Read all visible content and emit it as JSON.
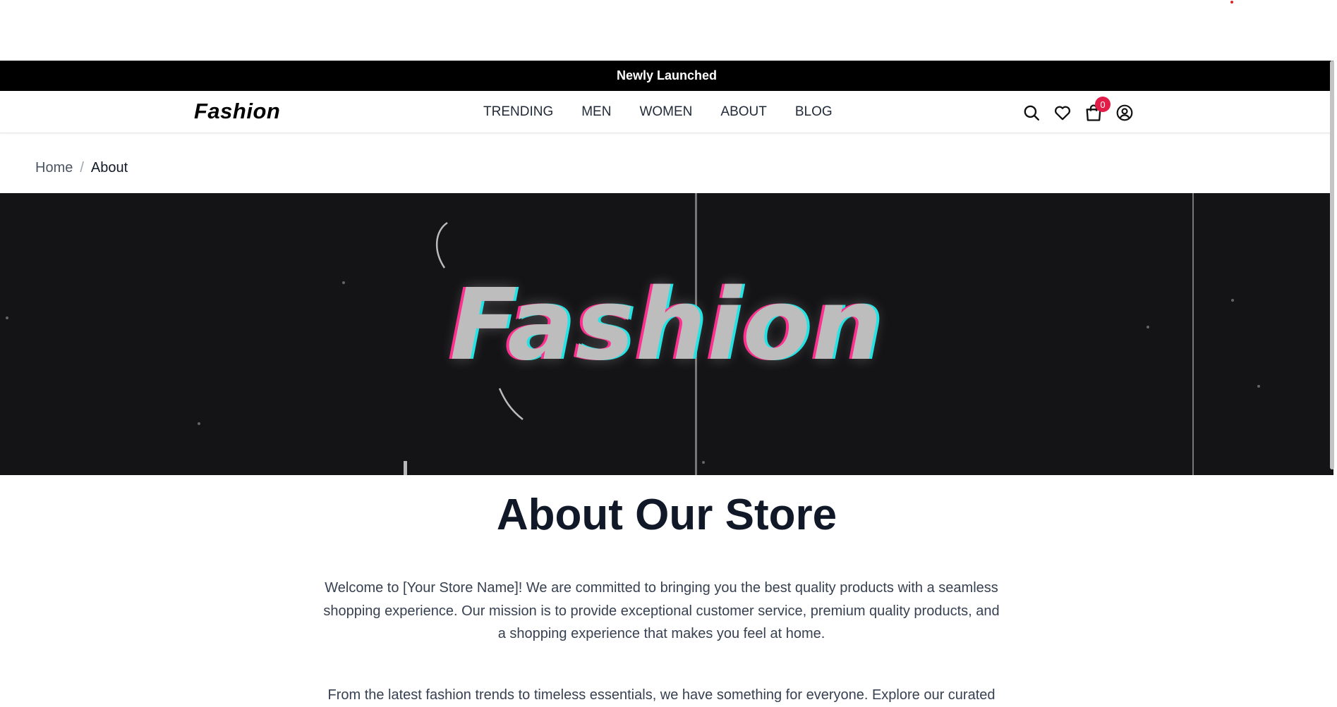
{
  "announcement": "Newly Launched",
  "header": {
    "logo": "Fashion",
    "nav": [
      "TRENDING",
      "MEN",
      "WOMEN",
      "ABOUT",
      "BLOG"
    ],
    "cart_count": "0",
    "icons": [
      "search-icon",
      "heart-icon",
      "shopping-bag-icon",
      "user-circle-icon"
    ]
  },
  "breadcrumb": {
    "home": "Home",
    "separator": "/",
    "current": "About"
  },
  "hero": {
    "text": "Fashion"
  },
  "about": {
    "title": "About Our Store",
    "paragraph1": "Welcome to [Your Store Name]! We are committed to bringing you the best quality products with a seamless shopping experience. Our mission is to provide exceptional customer service, premium quality products, and a shopping experience that makes you feel at home.",
    "paragraph2": "From the latest fashion trends to timeless essentials, we have something for everyone. Explore our curated"
  },
  "colors": {
    "announcement_bg": "#000000",
    "badge": "#e11d48",
    "hero_bg": "#141416"
  }
}
